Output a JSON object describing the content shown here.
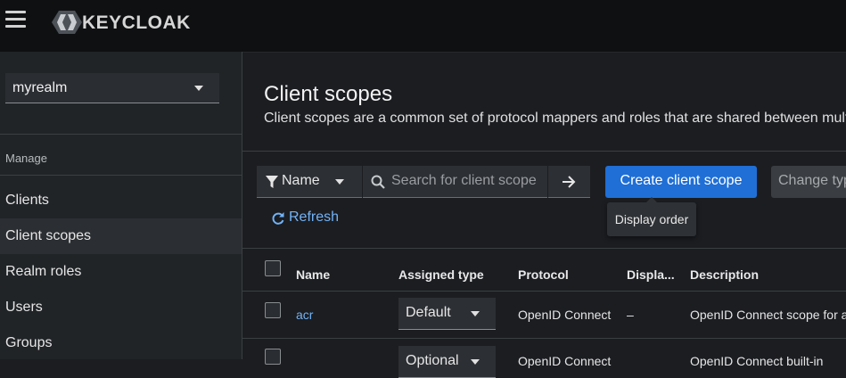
{
  "header": {
    "logo_text": "KEYCLOAK"
  },
  "sidebar": {
    "realm": "myrealm",
    "section_label": "Manage",
    "items": [
      {
        "label": "Clients"
      },
      {
        "label": "Client scopes"
      },
      {
        "label": "Realm roles"
      },
      {
        "label": "Users"
      },
      {
        "label": "Groups"
      }
    ],
    "active_item": "Client scopes"
  },
  "main": {
    "title": "Client scopes",
    "description": "Client scopes are a common set of protocol mappers and roles that are shared between mult",
    "toolbar": {
      "filter_label": "Name",
      "search_placeholder": "Search for client scope",
      "create_label": "Create client scope",
      "change_type_label": "Change type",
      "refresh_label": "Refresh"
    },
    "tooltip": "Display order",
    "table": {
      "columns": [
        "Name",
        "Assigned type",
        "Protocol",
        "Displa...",
        "Description"
      ],
      "rows": [
        {
          "name": "acr",
          "assigned_type": "Default",
          "protocol": "OpenID Connect",
          "display_order": "–",
          "description": "OpenID Connect scope for a"
        },
        {
          "name": "",
          "assigned_type": "Optional",
          "protocol": "OpenID Connect",
          "display_order": "",
          "description": "OpenID Connect built-in"
        }
      ]
    }
  },
  "colors": {
    "primary": "#1f6fd6",
    "link": "#73b2f5",
    "background": "#1b1d21",
    "topbar": "#0f1012",
    "sidebar": "#212427"
  }
}
